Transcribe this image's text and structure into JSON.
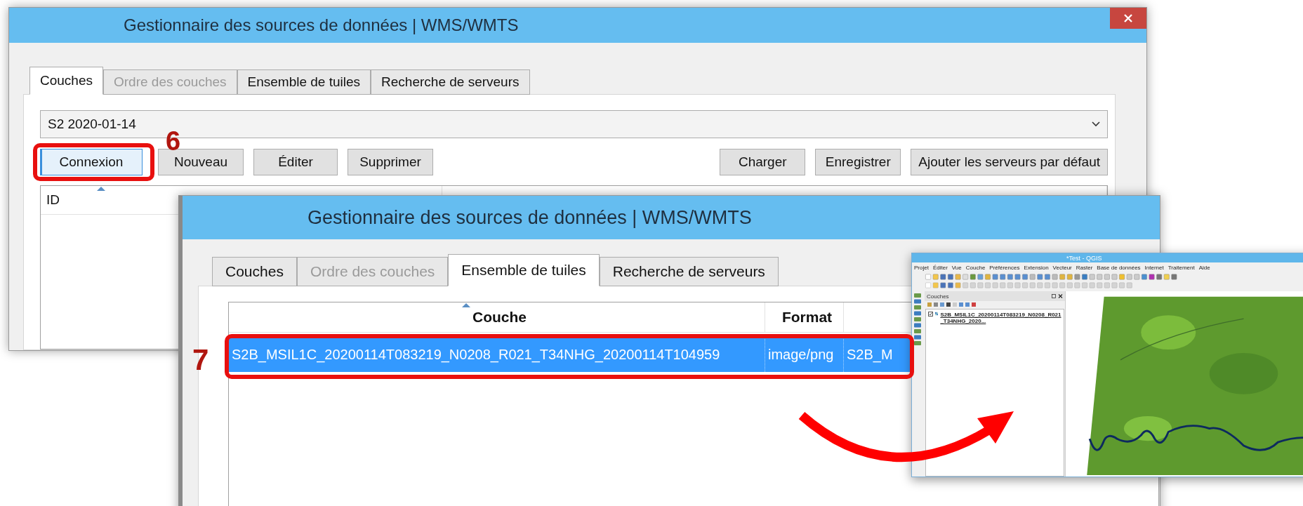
{
  "back_window": {
    "title": "Gestionnaire des sources de données | WMS/WMTS",
    "tabs": [
      {
        "label": "Couches",
        "selected": true,
        "disabled": false
      },
      {
        "label": "Ordre des couches",
        "selected": false,
        "disabled": true
      },
      {
        "label": "Ensemble de tuiles",
        "selected": false,
        "disabled": false
      },
      {
        "label": "Recherche de serveurs",
        "selected": false,
        "disabled": false
      }
    ],
    "connection": "S2 2020-01-14",
    "buttons": [
      {
        "label": "Connexion",
        "focused": true
      },
      {
        "label": "Nouveau",
        "focused": false
      },
      {
        "label": "Éditer",
        "focused": false
      },
      {
        "label": "Supprimer",
        "focused": false
      }
    ],
    "right_buttons": [
      {
        "label": "Charger"
      },
      {
        "label": "Enregistrer"
      },
      {
        "label": "Ajouter les serveurs par défaut"
      }
    ],
    "table": {
      "columns": [
        {
          "label": "ID",
          "sorted": true
        }
      ]
    }
  },
  "front_window": {
    "title": "Gestionnaire des sources de données | WMS/WMTS",
    "tabs": [
      {
        "label": "Couches",
        "selected": false,
        "disabled": false
      },
      {
        "label": "Ordre des couches",
        "selected": false,
        "disabled": true
      },
      {
        "label": "Ensemble de tuiles",
        "selected": true,
        "disabled": false
      },
      {
        "label": "Recherche de serveurs",
        "selected": false,
        "disabled": false
      }
    ],
    "table": {
      "columns": [
        {
          "label": "Couche",
          "sorted": true
        },
        {
          "label": "Format",
          "sorted": false
        }
      ],
      "rows": [
        {
          "cells": [
            "S2B_MSIL1C_20200114T083219_N0208_R021_T34NHG_20200114T104959",
            "image/png",
            "S2B_M"
          ],
          "selected": true
        }
      ]
    }
  },
  "qgis_window": {
    "title": "*Test - QGIS",
    "menu": [
      "Projet",
      "Éditer",
      "Vue",
      "Couche",
      "Préférences",
      "Extension",
      "Vecteur",
      "Raster",
      "Base de données",
      "Internet",
      "Traitement",
      "Aide"
    ],
    "layers_panel": {
      "title": "Couches",
      "layers": [
        {
          "name": "S2B_MSIL1C_20200114T083219_N0208_R021_T34NHG_2020...",
          "checked": true
        }
      ]
    }
  },
  "annotations": [
    {
      "label": "6"
    },
    {
      "label": "7"
    }
  ]
}
